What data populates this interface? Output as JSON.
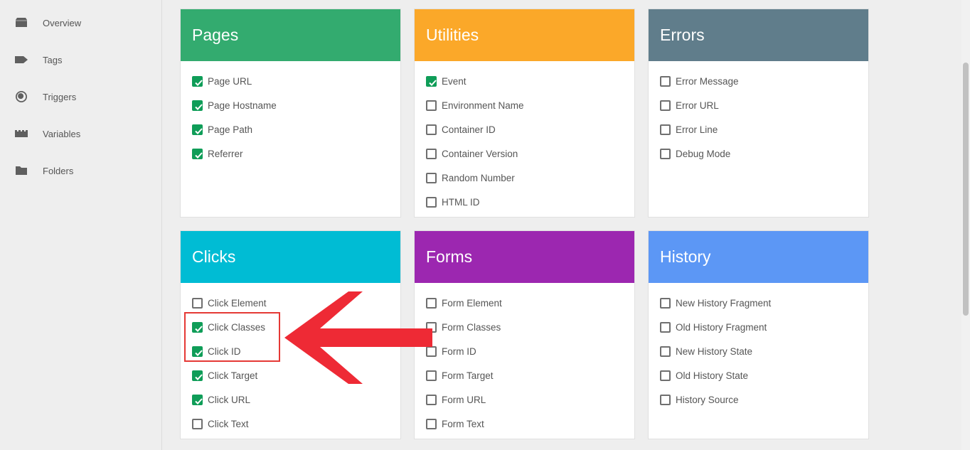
{
  "sidebar": {
    "items": [
      {
        "label": "Overview",
        "icon": "overview-icon"
      },
      {
        "label": "Tags",
        "icon": "tag-icon"
      },
      {
        "label": "Triggers",
        "icon": "trigger-icon"
      },
      {
        "label": "Variables",
        "icon": "variables-icon"
      },
      {
        "label": "Folders",
        "icon": "folder-icon"
      }
    ]
  },
  "cards": [
    {
      "title": "Pages",
      "color": "#33ab6f",
      "items": [
        {
          "label": "Page URL",
          "checked": true
        },
        {
          "label": "Page Hostname",
          "checked": true
        },
        {
          "label": "Page Path",
          "checked": true
        },
        {
          "label": "Referrer",
          "checked": true
        }
      ]
    },
    {
      "title": "Utilities",
      "color": "#fba829",
      "items": [
        {
          "label": "Event",
          "checked": true
        },
        {
          "label": "Environment Name",
          "checked": false
        },
        {
          "label": "Container ID",
          "checked": false
        },
        {
          "label": "Container Version",
          "checked": false
        },
        {
          "label": "Random Number",
          "checked": false
        },
        {
          "label": "HTML ID",
          "checked": false
        }
      ]
    },
    {
      "title": "Errors",
      "color": "#607d8b",
      "items": [
        {
          "label": "Error Message",
          "checked": false
        },
        {
          "label": "Error URL",
          "checked": false
        },
        {
          "label": "Error Line",
          "checked": false
        },
        {
          "label": "Debug Mode",
          "checked": false
        }
      ]
    },
    {
      "title": "Clicks",
      "color": "#00bcd4",
      "items": [
        {
          "label": "Click Element",
          "checked": false
        },
        {
          "label": "Click Classes",
          "checked": true
        },
        {
          "label": "Click ID",
          "checked": true
        },
        {
          "label": "Click Target",
          "checked": true
        },
        {
          "label": "Click URL",
          "checked": true
        },
        {
          "label": "Click Text",
          "checked": false
        }
      ]
    },
    {
      "title": "Forms",
      "color": "#9c27b0",
      "items": [
        {
          "label": "Form Element",
          "checked": false
        },
        {
          "label": "Form Classes",
          "checked": false
        },
        {
          "label": "Form ID",
          "checked": false
        },
        {
          "label": "Form Target",
          "checked": false
        },
        {
          "label": "Form URL",
          "checked": false
        },
        {
          "label": "Form Text",
          "checked": false
        }
      ]
    },
    {
      "title": "History",
      "color": "#5c97f5",
      "items": [
        {
          "label": "New History Fragment",
          "checked": false
        },
        {
          "label": "Old History Fragment",
          "checked": false
        },
        {
          "label": "New History State",
          "checked": false
        },
        {
          "label": "Old History State",
          "checked": false
        },
        {
          "label": "History Source",
          "checked": false
        }
      ]
    }
  ],
  "annotation": {
    "arrow_color": "#ee2a35",
    "highlight_color": "#e53935"
  }
}
